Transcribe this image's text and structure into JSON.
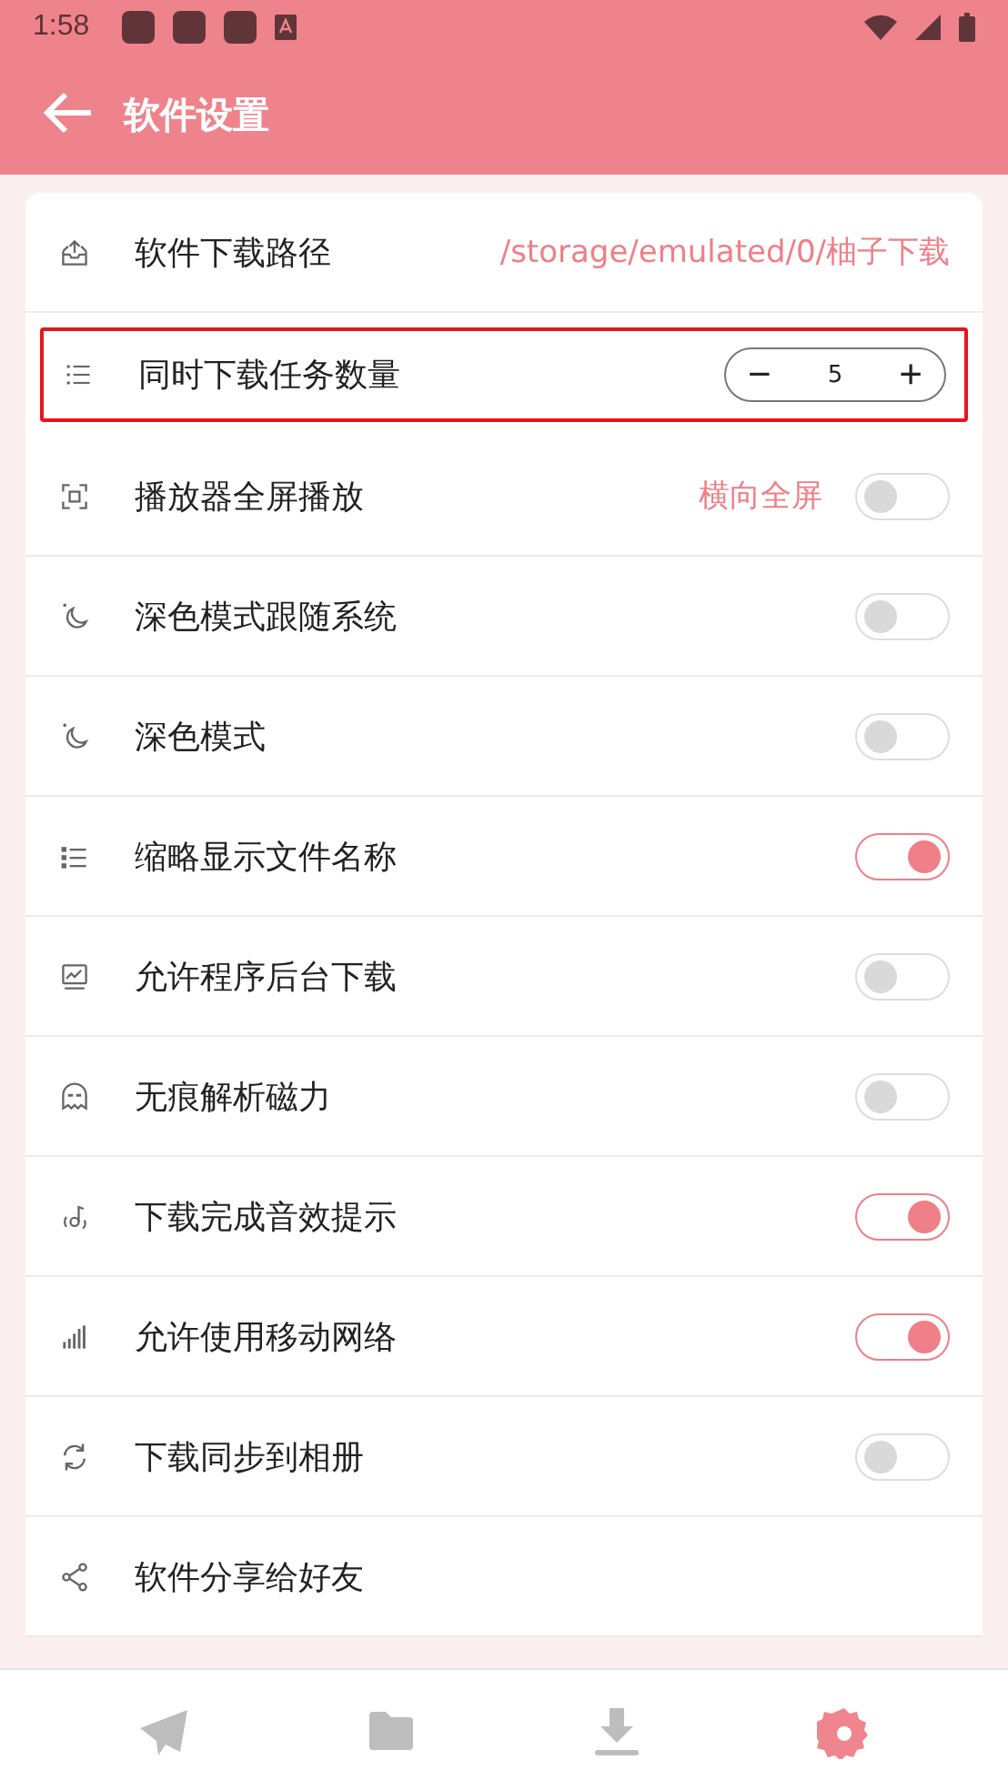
{
  "status_bar": {
    "time": "1:58"
  },
  "app_bar": {
    "title": "软件设置"
  },
  "settings": [
    {
      "kind": "path",
      "label": "软件下载路径",
      "value": "/storage/emulated/0/柚子下载",
      "highlighted": false
    },
    {
      "kind": "stepper",
      "label": "同时下载任务数量",
      "value": "5",
      "minus": "−",
      "plus": "+",
      "highlighted": true
    },
    {
      "kind": "toggle",
      "label": "播放器全屏播放",
      "value": "横向全屏",
      "on": false,
      "highlighted": false
    },
    {
      "kind": "toggle",
      "label": "深色模式跟随系统",
      "on": false,
      "highlighted": false
    },
    {
      "kind": "toggle",
      "label": "深色模式",
      "on": false,
      "highlighted": false
    },
    {
      "kind": "toggle",
      "label": "缩略显示文件名称",
      "on": true,
      "highlighted": false
    },
    {
      "kind": "toggle",
      "label": "允许程序后台下载",
      "on": false,
      "highlighted": false
    },
    {
      "kind": "toggle",
      "label": "无痕解析磁力",
      "on": false,
      "highlighted": false
    },
    {
      "kind": "toggle",
      "label": "下载完成音效提示",
      "on": true,
      "highlighted": false
    },
    {
      "kind": "toggle",
      "label": "允许使用移动网络",
      "on": true,
      "highlighted": false
    },
    {
      "kind": "toggle",
      "label": "下载同步到相册",
      "on": false,
      "highlighted": false
    },
    {
      "kind": "plain",
      "label": "软件分享给好友",
      "highlighted": false
    }
  ],
  "bottom_nav": [
    {
      "selected": false
    },
    {
      "selected": false
    },
    {
      "selected": false
    },
    {
      "selected": true
    }
  ]
}
